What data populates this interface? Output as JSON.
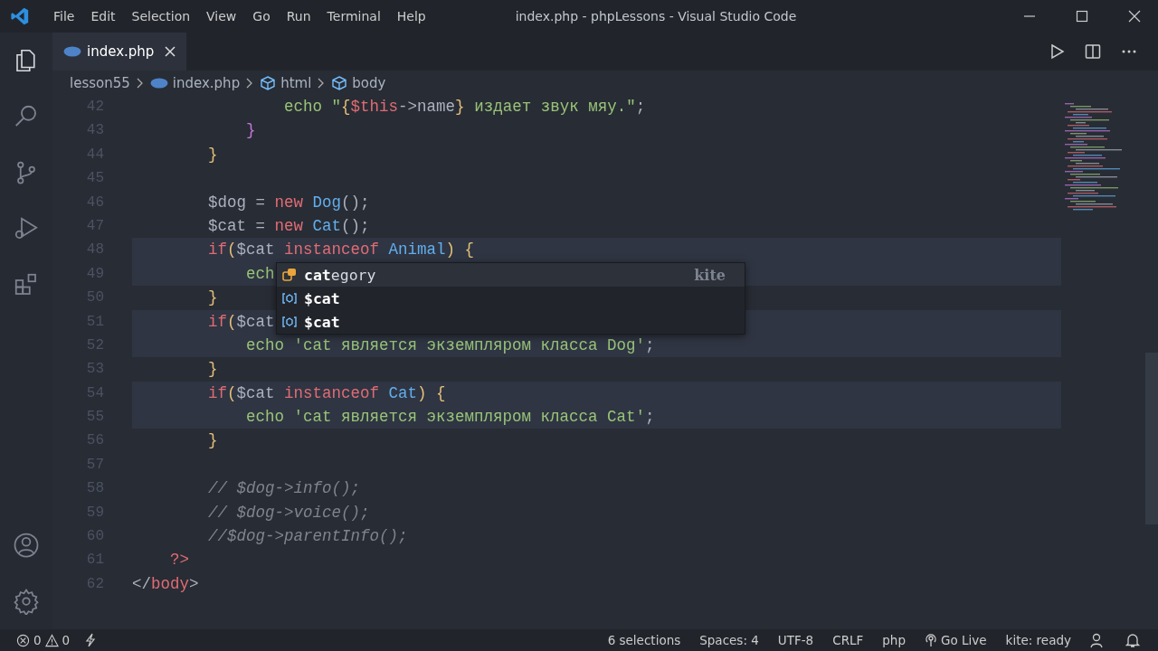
{
  "window": {
    "title": "index.php - phpLessons - Visual Studio Code"
  },
  "menu": [
    "File",
    "Edit",
    "Selection",
    "View",
    "Go",
    "Run",
    "Terminal",
    "Help"
  ],
  "activity_bar": [
    {
      "kind": "explorer",
      "selected": true
    },
    {
      "kind": "search",
      "selected": false
    },
    {
      "kind": "source-control",
      "selected": false
    },
    {
      "kind": "debug",
      "selected": false
    },
    {
      "kind": "extensions",
      "selected": false
    }
  ],
  "activity_bar_bottom": [
    {
      "kind": "account"
    },
    {
      "kind": "settings"
    }
  ],
  "tabs": [
    {
      "label": "index.php",
      "selected": true
    }
  ],
  "breadcrumbs": [
    {
      "label": "lesson55",
      "kind": "folder"
    },
    {
      "label": "index.php",
      "kind": "php"
    },
    {
      "label": "html",
      "kind": "element"
    },
    {
      "label": "body",
      "kind": "element"
    }
  ],
  "code_lines": [
    {
      "number": "42",
      "highlighted": false,
      "tokens": [
        {
          "text": "                echo ",
          "kind": "builtin"
        },
        {
          "text": "\"",
          "kind": "string"
        },
        {
          "text": "{",
          "kind": "bracket"
        },
        {
          "text": "$this",
          "kind": "keyword"
        },
        {
          "text": "->name",
          "kind": "plain"
        },
        {
          "text": "}",
          "kind": "bracket"
        },
        {
          "text": " издает звук мяу.\"",
          "kind": "string"
        },
        {
          "text": ";",
          "kind": "plain"
        }
      ]
    },
    {
      "number": "43",
      "highlighted": false,
      "tokens": [
        {
          "text": "            }",
          "kind": "bracket2"
        }
      ]
    },
    {
      "number": "44",
      "highlighted": false,
      "tokens": [
        {
          "text": "        }",
          "kind": "bracket"
        }
      ]
    },
    {
      "number": "45",
      "highlighted": false
    },
    {
      "number": "46",
      "highlighted": false,
      "tokens": [
        {
          "text": "        $dog = ",
          "kind": "plain"
        },
        {
          "text": "new ",
          "kind": "keyword"
        },
        {
          "text": "Dog",
          "kind": "class"
        },
        {
          "text": "();",
          "kind": "plain"
        }
      ]
    },
    {
      "number": "47",
      "highlighted": false,
      "tokens": [
        {
          "text": "        $cat = ",
          "kind": "plain"
        },
        {
          "text": "new ",
          "kind": "keyword"
        },
        {
          "text": "Cat",
          "kind": "class"
        },
        {
          "text": "();",
          "kind": "plain"
        }
      ]
    },
    {
      "number": "48",
      "highlighted": true,
      "tokens": [
        {
          "text": "        if",
          "kind": "keyword"
        },
        {
          "text": "(",
          "kind": "bracket"
        },
        {
          "text": "$cat ",
          "kind": "plain"
        },
        {
          "text": "instanceof ",
          "kind": "keyword"
        },
        {
          "text": "Animal",
          "kind": "class"
        },
        {
          "text": ") {",
          "kind": "bracket"
        }
      ]
    },
    {
      "number": "49",
      "highlighted": true,
      "tokens": [
        {
          "text": "            ech",
          "kind": "builtin"
        }
      ]
    },
    {
      "number": "50",
      "highlighted": false,
      "tokens": [
        {
          "text": "        }",
          "kind": "bracket"
        }
      ]
    },
    {
      "number": "51",
      "highlighted": true,
      "tokens": [
        {
          "text": "        if",
          "kind": "keyword"
        },
        {
          "text": "(",
          "kind": "bracket"
        },
        {
          "text": "$cat",
          "kind": "plain"
        }
      ]
    },
    {
      "number": "52",
      "highlighted": true,
      "tokens": [
        {
          "text": "            echo ",
          "kind": "builtin"
        },
        {
          "text": "'cat является экземпляром класса Dog'",
          "kind": "string"
        },
        {
          "text": ";",
          "kind": "plain"
        }
      ]
    },
    {
      "number": "53",
      "highlighted": false,
      "tokens": [
        {
          "text": "        }",
          "kind": "bracket"
        }
      ]
    },
    {
      "number": "54",
      "highlighted": true,
      "tokens": [
        {
          "text": "        if",
          "kind": "keyword"
        },
        {
          "text": "(",
          "kind": "bracket"
        },
        {
          "text": "$cat ",
          "kind": "plain"
        },
        {
          "text": "instanceof ",
          "kind": "keyword"
        },
        {
          "text": "Cat",
          "kind": "class"
        },
        {
          "text": ") {",
          "kind": "bracket"
        }
      ]
    },
    {
      "number": "55",
      "highlighted": true,
      "tokens": [
        {
          "text": "            echo ",
          "kind": "builtin"
        },
        {
          "text": "'cat является экземпляром класса Cat'",
          "kind": "string"
        },
        {
          "text": ";",
          "kind": "plain"
        }
      ]
    },
    {
      "number": "56",
      "highlighted": false,
      "tokens": [
        {
          "text": "        }",
          "kind": "bracket"
        }
      ]
    },
    {
      "number": "57",
      "highlighted": false
    },
    {
      "number": "58",
      "highlighted": false,
      "tokens": [
        {
          "text": "        // $dog->info();",
          "kind": "comment"
        }
      ]
    },
    {
      "number": "59",
      "highlighted": false,
      "tokens": [
        {
          "text": "        // $dog->voice();",
          "kind": "comment"
        }
      ]
    },
    {
      "number": "60",
      "highlighted": false,
      "tokens": [
        {
          "text": "        //$dog->parentInfo();",
          "kind": "comment"
        }
      ]
    },
    {
      "number": "61",
      "highlighted": false,
      "tokens": [
        {
          "text": "    ?>",
          "kind": "keyword"
        }
      ]
    },
    {
      "number": "62",
      "highlighted": false,
      "tokens": [
        {
          "text": "</",
          "kind": "plain"
        },
        {
          "text": "body",
          "kind": "keyword"
        },
        {
          "text": ">",
          "kind": "plain"
        }
      ]
    }
  ],
  "suggestions": [
    {
      "kind": "property",
      "label": "**cat**egory",
      "source": "kite",
      "selected": true
    },
    {
      "kind": "variable",
      "label": "**$cat**",
      "selected": false
    },
    {
      "kind": "variable",
      "label": "**$cat**",
      "selected": false
    }
  ],
  "status_bar": {
    "errors": "0",
    "warnings": "0",
    "items": [
      "6 selections",
      "Spaces: 4",
      "UTF-8",
      "CRLF",
      "php"
    ],
    "go_live": "Go Live",
    "kite": "kite: ready"
  }
}
